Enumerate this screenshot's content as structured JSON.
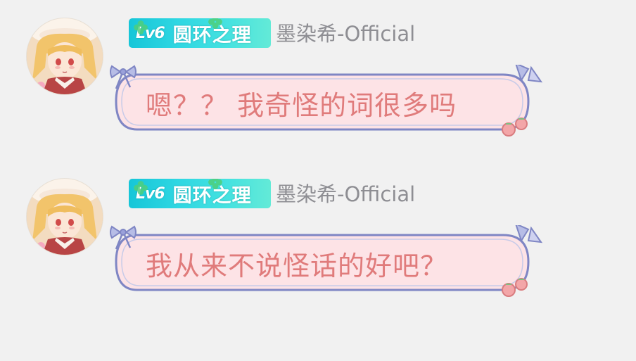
{
  "messages": [
    {
      "level_badge": "Lv6",
      "title_badge": "圆环之理",
      "username": "墨染希-Official",
      "text": "嗯？？ 我奇怪的词很多吗"
    },
    {
      "level_badge": "Lv6",
      "title_badge": "圆环之理",
      "username": "墨染希-Official",
      "text": "我从来不说怪话的好吧？"
    }
  ],
  "colors": {
    "background": "#f1f1f1",
    "badge_start": "#16c6d8",
    "badge_end": "#63ead7",
    "username": "#8e8e93",
    "bubble_fill": "#fde3e6",
    "bubble_border": "#7f86c4",
    "bubble_text": "#e07b7b"
  },
  "icons": {
    "avatar": "anime-girl-avatar",
    "badge_decoration": "clover-icon",
    "bubble_decor_left": "ribbon-bow-icon",
    "bubble_decor_right": "triangle-sparkle-icon",
    "bubble_decor_bottom": "strawberry-icon"
  }
}
